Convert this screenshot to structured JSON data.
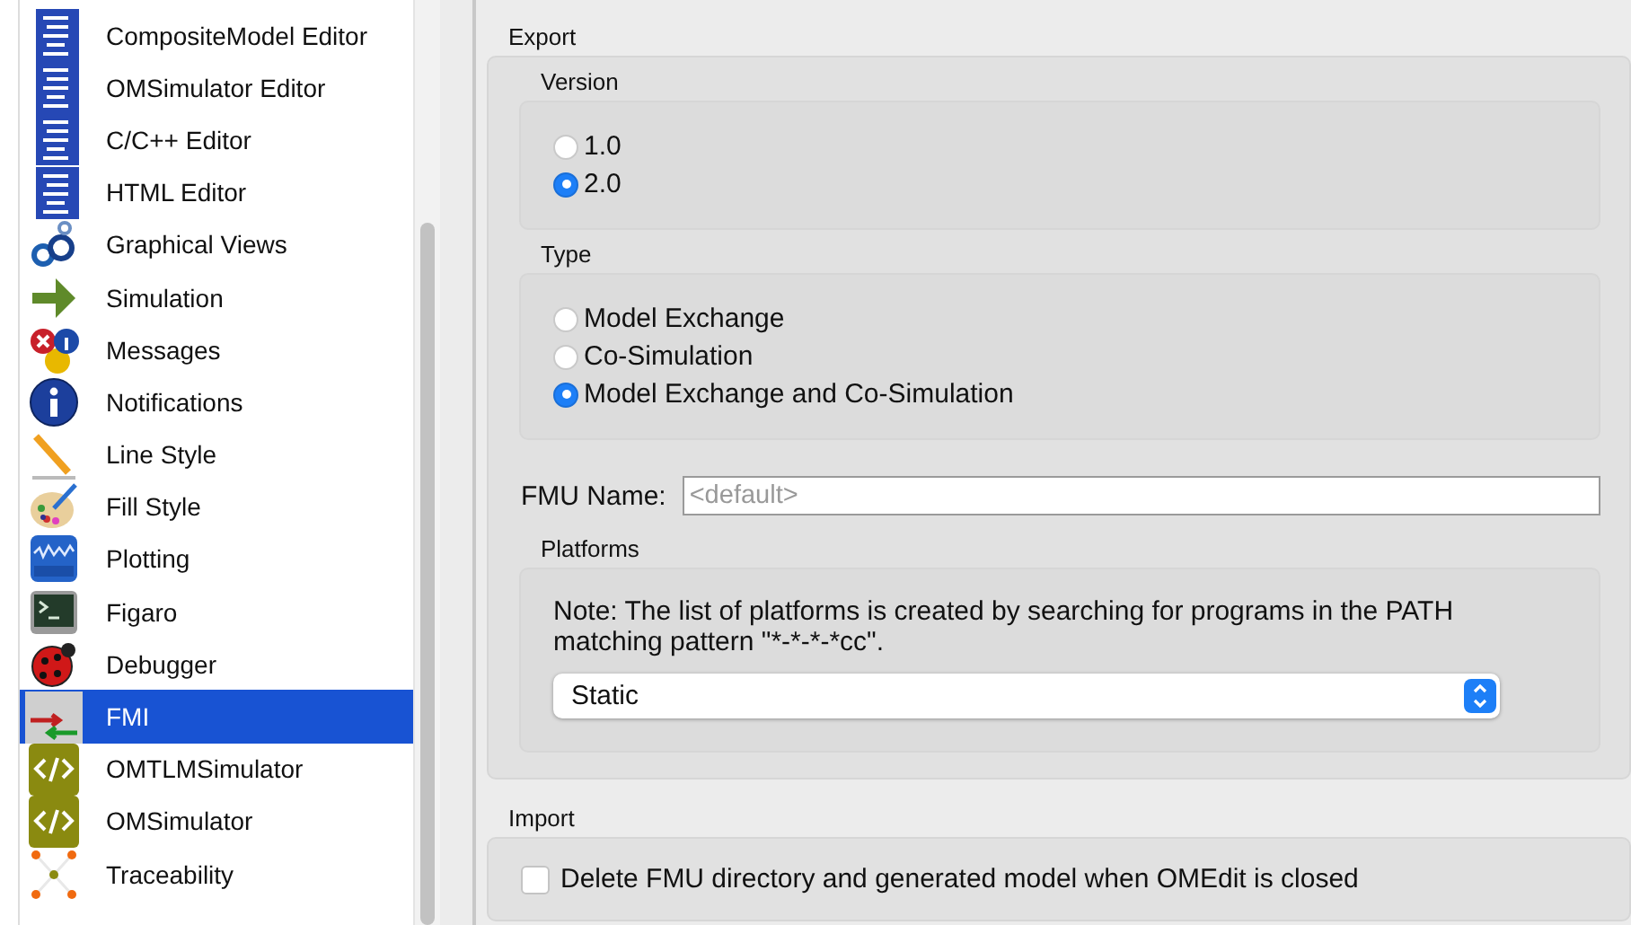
{
  "sidebar": {
    "items": [
      {
        "label": "CompositeModel Editor",
        "selected": false
      },
      {
        "label": "OMSimulator Editor",
        "selected": false
      },
      {
        "label": "C/C++ Editor",
        "selected": false
      },
      {
        "label": "HTML Editor",
        "selected": false
      },
      {
        "label": "Graphical Views",
        "selected": false
      },
      {
        "label": "Simulation",
        "selected": false
      },
      {
        "label": "Messages",
        "selected": false
      },
      {
        "label": "Notifications",
        "selected": false
      },
      {
        "label": "Line Style",
        "selected": false
      },
      {
        "label": "Fill Style",
        "selected": false
      },
      {
        "label": "Plotting",
        "selected": false
      },
      {
        "label": "Figaro",
        "selected": false
      },
      {
        "label": "Debugger",
        "selected": false
      },
      {
        "label": "FMI",
        "selected": true
      },
      {
        "label": "OMTLMSimulator",
        "selected": false
      },
      {
        "label": "OMSimulator",
        "selected": false
      },
      {
        "label": "Traceability",
        "selected": false
      }
    ]
  },
  "export": {
    "title": "Export",
    "version": {
      "title": "Version",
      "options": [
        {
          "label": "1.0",
          "selected": false
        },
        {
          "label": "2.0",
          "selected": true
        }
      ]
    },
    "type": {
      "title": "Type",
      "options": [
        {
          "label": "Model Exchange",
          "selected": false
        },
        {
          "label": "Co-Simulation",
          "selected": false
        },
        {
          "label": "Model Exchange and Co-Simulation",
          "selected": true
        }
      ]
    },
    "fmu_name": {
      "label": "FMU Name:",
      "placeholder": "<default>"
    },
    "platforms": {
      "title": "Platforms",
      "note": "Note: The list of platforms is created by searching for programs in the PATH matching pattern \"*-*-*-*cc\".",
      "select": {
        "value": "Static"
      }
    }
  },
  "import": {
    "title": "Import",
    "options": [
      {
        "label": "Delete FMU directory and generated model when OMEdit is closed",
        "checked": false
      }
    ]
  }
}
